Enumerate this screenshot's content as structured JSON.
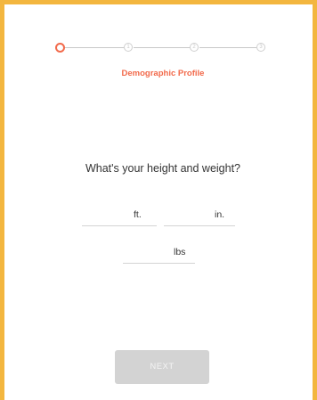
{
  "stepper": {
    "steps": [
      {
        "number": "",
        "state": "active"
      },
      {
        "number": "1",
        "state": "pending"
      },
      {
        "number": "2",
        "state": "pending"
      },
      {
        "number": "3",
        "state": "pending"
      }
    ],
    "caption": "Demographic Profile"
  },
  "form": {
    "question": "What's your height and weight?",
    "height_feet": {
      "value": "",
      "unit": "ft."
    },
    "height_inches": {
      "value": "",
      "unit": "in."
    },
    "weight": {
      "value": "",
      "unit": "lbs"
    }
  },
  "actions": {
    "next_label": "NEXT",
    "next_enabled": false
  },
  "colors": {
    "accent": "#f26a4b",
    "frame_border": "#f3b63f",
    "disabled_button": "#d3d3d3"
  }
}
